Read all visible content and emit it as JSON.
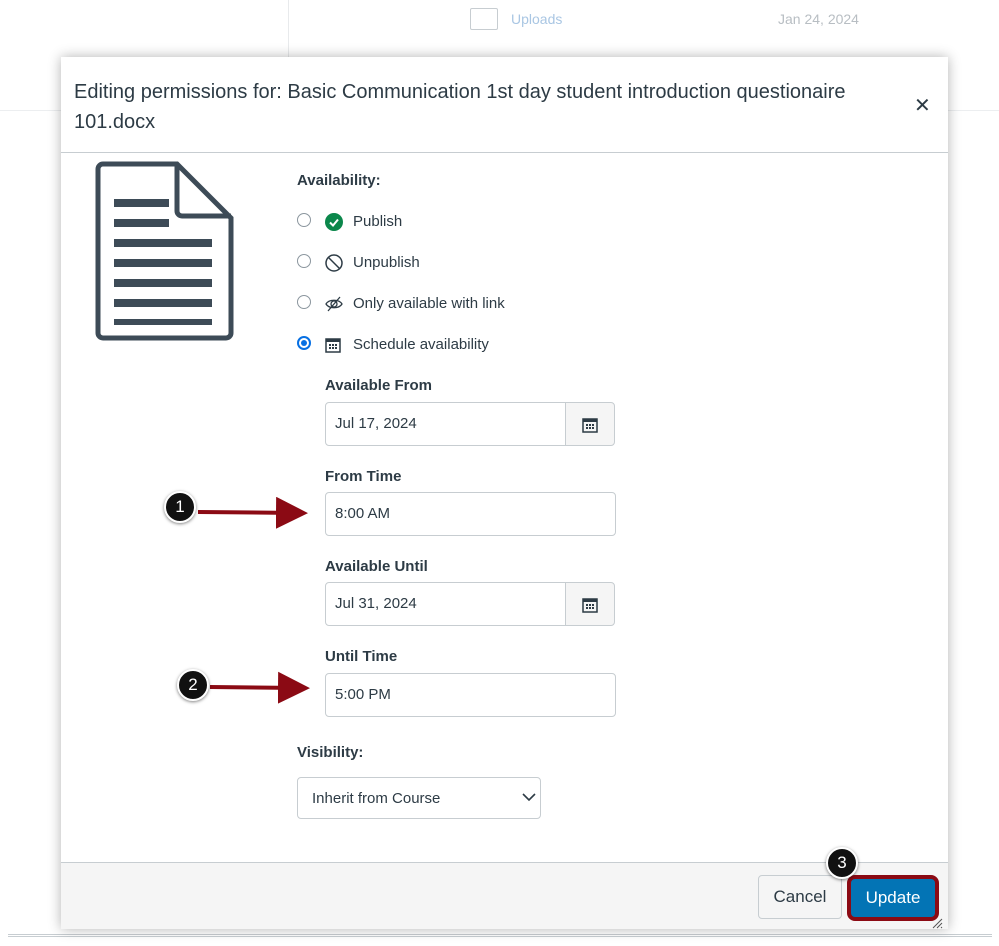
{
  "background": {
    "folder_link": "Uploads",
    "date": "Jan 24, 2024"
  },
  "modal": {
    "title": "Editing permissions for: Basic Communication 1st day student introduction questionaire 101.docx",
    "close_icon": "close-icon",
    "availability_label": "Availability:",
    "options": [
      {
        "label": "Publish",
        "icon": "check-circle-icon",
        "selected": false
      },
      {
        "label": "Unpublish",
        "icon": "no-icon",
        "selected": false
      },
      {
        "label": "Only available with link",
        "icon": "eye-off-icon",
        "selected": false
      },
      {
        "label": "Schedule availability",
        "icon": "calendar-icon",
        "selected": true
      }
    ],
    "available_from_label": "Available From",
    "available_from_value": "Jul 17, 2024",
    "from_time_label": "From Time",
    "from_time_value": "8:00 AM",
    "available_until_label": "Available Until",
    "available_until_value": "Jul 31, 2024",
    "until_time_label": "Until Time",
    "until_time_value": "5:00 PM",
    "visibility_label": "Visibility:",
    "visibility_value": "Inherit from Course",
    "cancel_label": "Cancel",
    "update_label": "Update"
  },
  "annotations": [
    "1",
    "2",
    "3"
  ],
  "colors": {
    "accent": "#0374b5",
    "radio": "#0770e3",
    "publish": "#0b874b",
    "annotation": "#8b0a14"
  }
}
